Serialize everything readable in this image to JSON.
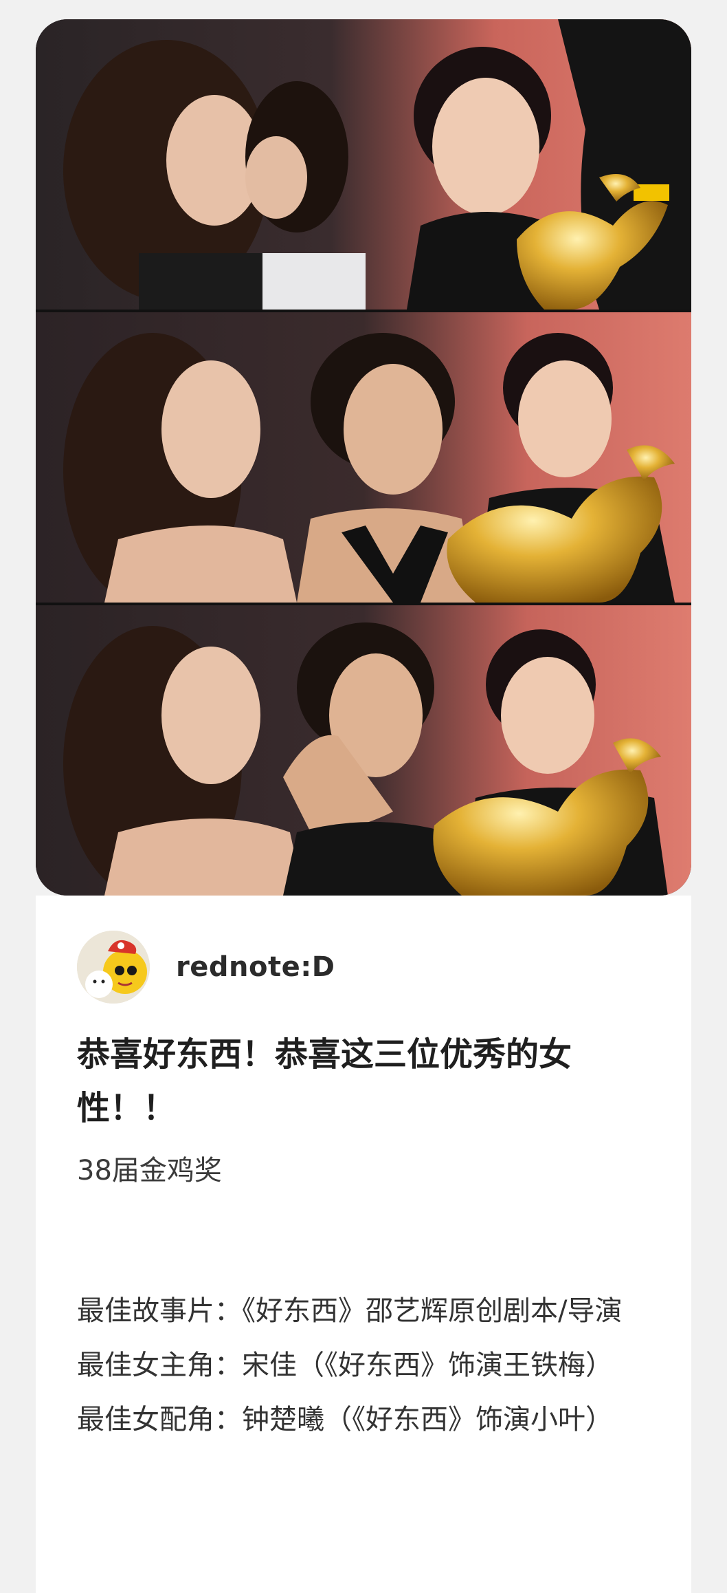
{
  "gallery": {
    "photo_count": 3,
    "photo_descriptions": []
  },
  "post": {
    "author_name": "rednote:D",
    "title": "恭喜好东西！恭喜这三位优秀的女性！！",
    "subtitle": "38届金鸡奖",
    "credits": [
      "最佳故事片：《好东西》邵艺辉原创剧本/导演",
      "最佳女主角：宋佳（《好东西》饰演王铁梅）",
      "最佳女配角：钟楚曦（《好东西》饰演小叶）"
    ]
  },
  "colors": {
    "page_background": "#f1f1f1",
    "card_background": "#ffffff",
    "backdrop_red": "#d46a60",
    "backdrop_dark": "#2a2426",
    "trophy_gold": "#d9a326",
    "dress_black": "#121212",
    "text_primary": "#1f1f1f"
  }
}
